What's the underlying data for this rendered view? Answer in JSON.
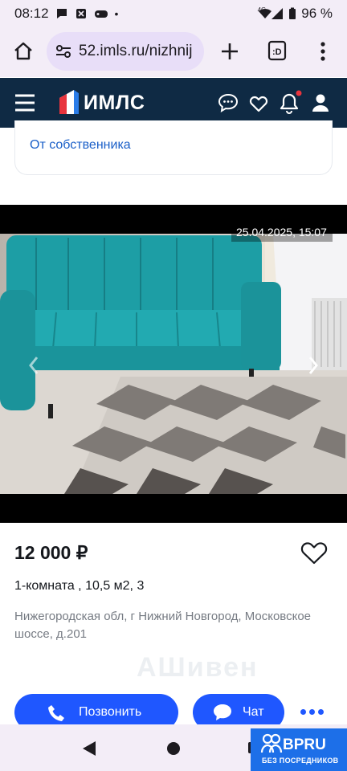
{
  "status": {
    "time": "08:12",
    "dot": "•",
    "network": "4G",
    "battery": "96 %"
  },
  "browser": {
    "url": "52.imls.ru/nizhnij"
  },
  "site": {
    "logo": "ИМЛС"
  },
  "listing": {
    "owner_link": "От собственника",
    "photo_date": "25.04.2025, 15:07",
    "price": "12 000 ₽",
    "rooms": "1-комната , 10,5 м2, 3",
    "address": "Нижегородская обл, г Нижний Новгород, Московское шоссе, д.201"
  },
  "actions": {
    "call_label": "Позвонить",
    "chat_label": "Чат"
  },
  "badge": {
    "title": "BPRU",
    "subtitle": "БЕЗ ПОСРЕДНИКОВ"
  },
  "colors": {
    "navbar": "#0f2a44",
    "accent": "#1f57ff",
    "link": "#1a5fc8"
  }
}
